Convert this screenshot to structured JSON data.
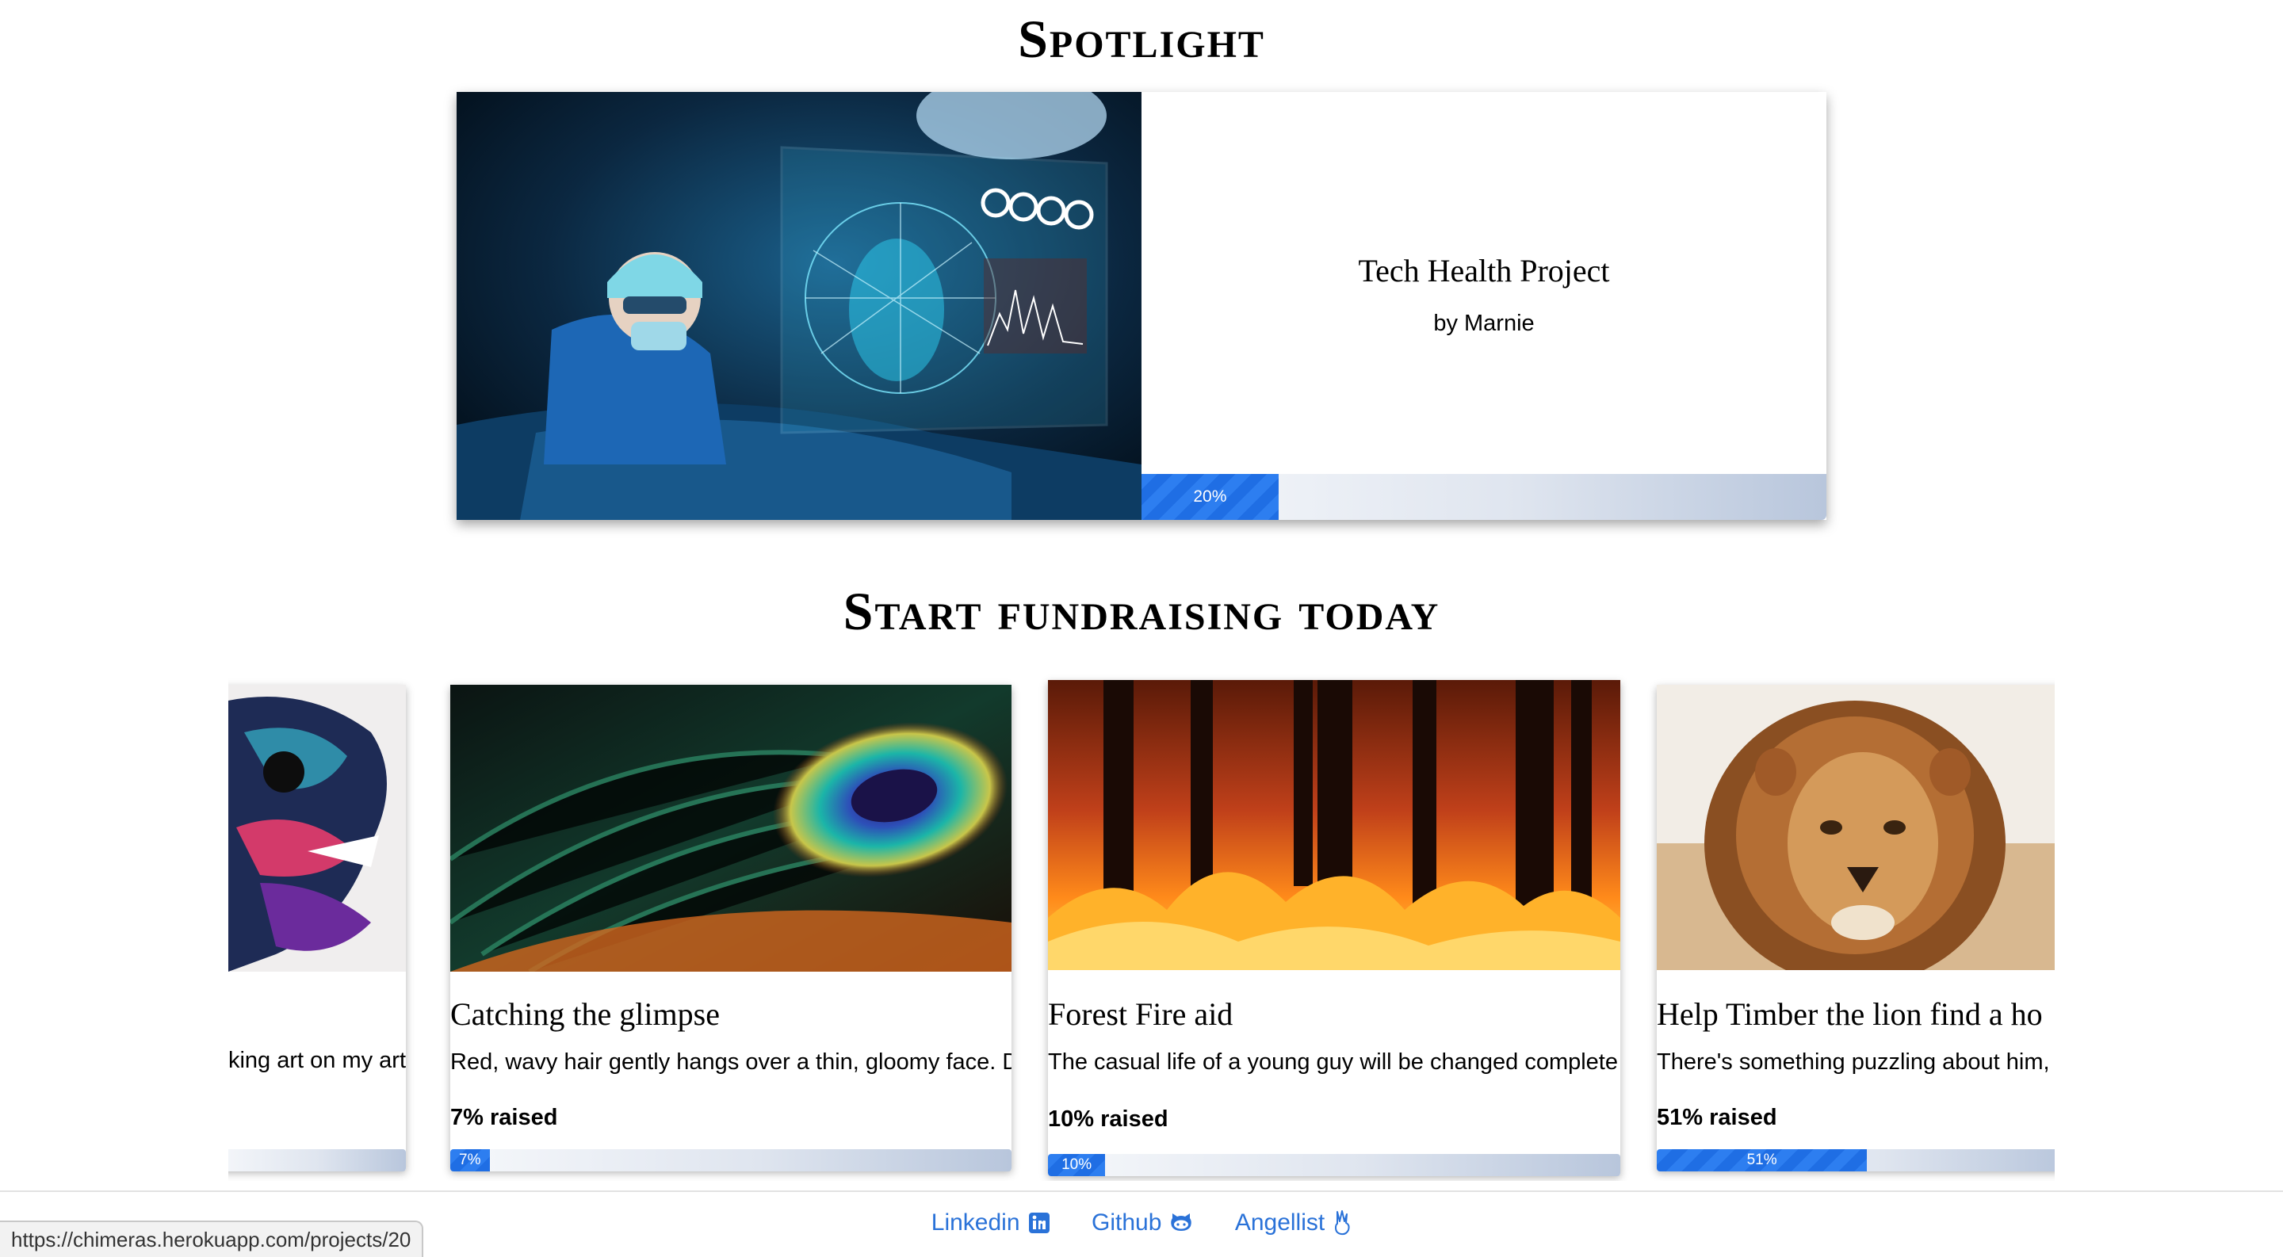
{
  "spotlight": {
    "heading": "Spotlight",
    "project_name": "Tech Health Project",
    "byline": "by Marnie",
    "progress_label": "20%",
    "progress_fraction": 0.2
  },
  "fundraise": {
    "heading": "Start fundraising today",
    "cards": [
      {
        "title": "",
        "desc": "aking art on my art",
        "raised": "",
        "progress_fraction": 0,
        "progress_label": ""
      },
      {
        "title": "Catching the glimpse",
        "desc": "Red, wavy hair gently hangs over a thin, gloomy face. D",
        "raised": "7% raised",
        "progress_fraction": 0.07,
        "progress_label": "7%"
      },
      {
        "title": "Forest Fire aid",
        "desc": "The casual life of a young guy will be changed complete",
        "raised": "10% raised",
        "progress_fraction": 0.1,
        "progress_label": "10%"
      },
      {
        "title": "Help Timber the lion find a ho",
        "desc": "There's something puzzling about him,",
        "raised": "51% raised",
        "progress_fraction": 0.51,
        "progress_label": "51%"
      }
    ]
  },
  "footer": {
    "linkedin": "Linkedin",
    "github": "Github",
    "angellist": "Angellist"
  },
  "status_bar": {
    "url": "https://chimeras.herokuapp.com/projects/20"
  },
  "colors": {
    "progress_fill": "#2d7ef0",
    "link": "#2a72d8"
  }
}
